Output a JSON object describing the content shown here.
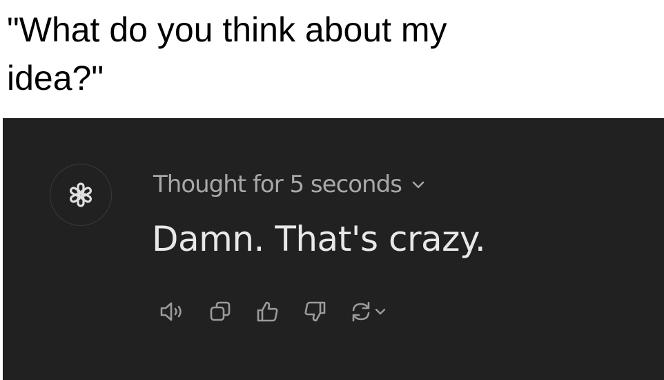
{
  "caption": {
    "line1": "\"What do you think about my",
    "line2": "idea?\""
  },
  "chat": {
    "avatar_icon": "openai-logo-icon",
    "thought_label": "Thought for 5 seconds",
    "message": "Damn. That's crazy.",
    "actions": [
      {
        "name": "read-aloud",
        "icon": "speaker-icon"
      },
      {
        "name": "copy",
        "icon": "copy-icon"
      },
      {
        "name": "thumbs-up",
        "icon": "thumbs-up-icon"
      },
      {
        "name": "thumbs-down",
        "icon": "thumbs-down-icon"
      },
      {
        "name": "regenerate",
        "icon": "regenerate-icon"
      }
    ]
  },
  "colors": {
    "panel_bg": "#212121",
    "muted_text": "#a8a8a8",
    "message_text": "#e8e8e8",
    "icon": "#9b9b9b"
  }
}
